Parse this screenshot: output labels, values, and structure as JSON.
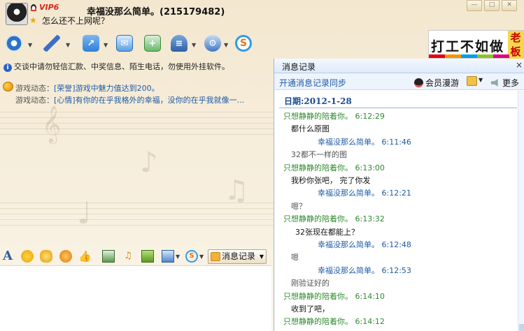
{
  "titlebar": {
    "vip_label": "VIP6",
    "contact_name": "幸福没那么简单。(215179482)",
    "status_text": "怎么还不上网呢？",
    "buttons": [
      "minimize",
      "maximize",
      "close"
    ]
  },
  "toolbar": {
    "buttons": [
      {
        "name": "video-icon",
        "color": "#2a73c9"
      },
      {
        "name": "microphone-icon",
        "color": "#3b6fc2"
      },
      {
        "name": "send-file-icon",
        "color": "#3c8be0"
      },
      {
        "name": "sms-icon",
        "color": "#3c8be0"
      },
      {
        "name": "create-group-icon",
        "color": "#3aa33a"
      },
      {
        "name": "apps-icon",
        "color": "#3e6fb5"
      },
      {
        "name": "settings-icon",
        "color": "#3f78c4"
      },
      {
        "name": "sogou-icon",
        "color": "#2e9de8"
      }
    ]
  },
  "ad": {
    "text": "打工不如做",
    "side_text": "老板"
  },
  "chat": {
    "notice": "交谈中请勿轻信汇款、中奖信息、陌生电话，勿使用外挂软件。",
    "game_rows": [
      {
        "label": "游戏动态：",
        "value": "[荣誉]游戏中魅力值达到200。"
      },
      {
        "label": "游戏动态：",
        "value": "[心情]有你的在乎我格外的幸福，没你的在乎我就像一..."
      }
    ]
  },
  "format_bar": {
    "icons": [
      "font-icon",
      "emoji-icon",
      "magic-emoji-icon",
      "shake-icon",
      "thumb-icon",
      "screenshot-icon",
      "music-icon",
      "gift-icon",
      "image-icon",
      "sogou-input-icon"
    ],
    "msg_record_label": "消息记录"
  },
  "history_panel": {
    "title": "消息记录",
    "close_label": "×",
    "sync_link": "开通消息记录同步",
    "member_label": "会员漫游",
    "more_label": "更多",
    "date_label": "日期:2012-1-28",
    "messages": [
      {
        "type": "hdr-g",
        "text": "只想静静的陪着你。 6:12:29"
      },
      {
        "type": "body",
        "text": "都什么原图"
      },
      {
        "type": "hdr-b",
        "text": "幸福没那么简单。 6:11:46"
      },
      {
        "type": "body-gray",
        "text": "32都不一样的图"
      },
      {
        "type": "hdr-g",
        "text": "只想静静的陪着你。 6:13:00"
      },
      {
        "type": "body",
        "text": "我秒你张吧， 完了你发"
      },
      {
        "type": "hdr-b",
        "text": "幸福没那么简单。 6:12:21"
      },
      {
        "type": "body-gray",
        "text": "嗯？"
      },
      {
        "type": "hdr-g",
        "text": "只想静静的陪着你。 6:13:32"
      },
      {
        "type": "body",
        "text": "32张现在都能上？"
      },
      {
        "type": "hdr-b",
        "text": "幸福没那么简单。 6:12:48"
      },
      {
        "type": "body-gray",
        "text": "嗯"
      },
      {
        "type": "hdr-b",
        "text": "幸福没那么简单。 6:12:53"
      },
      {
        "type": "body-gray",
        "text": "刚验证好的"
      },
      {
        "type": "hdr-g",
        "text": "只想静静的陪着你。 6:14:10"
      },
      {
        "type": "body",
        "text": "收到了吧，"
      },
      {
        "type": "hdr-g",
        "text": "只想静静的陪着你。 6:14:12"
      }
    ]
  }
}
